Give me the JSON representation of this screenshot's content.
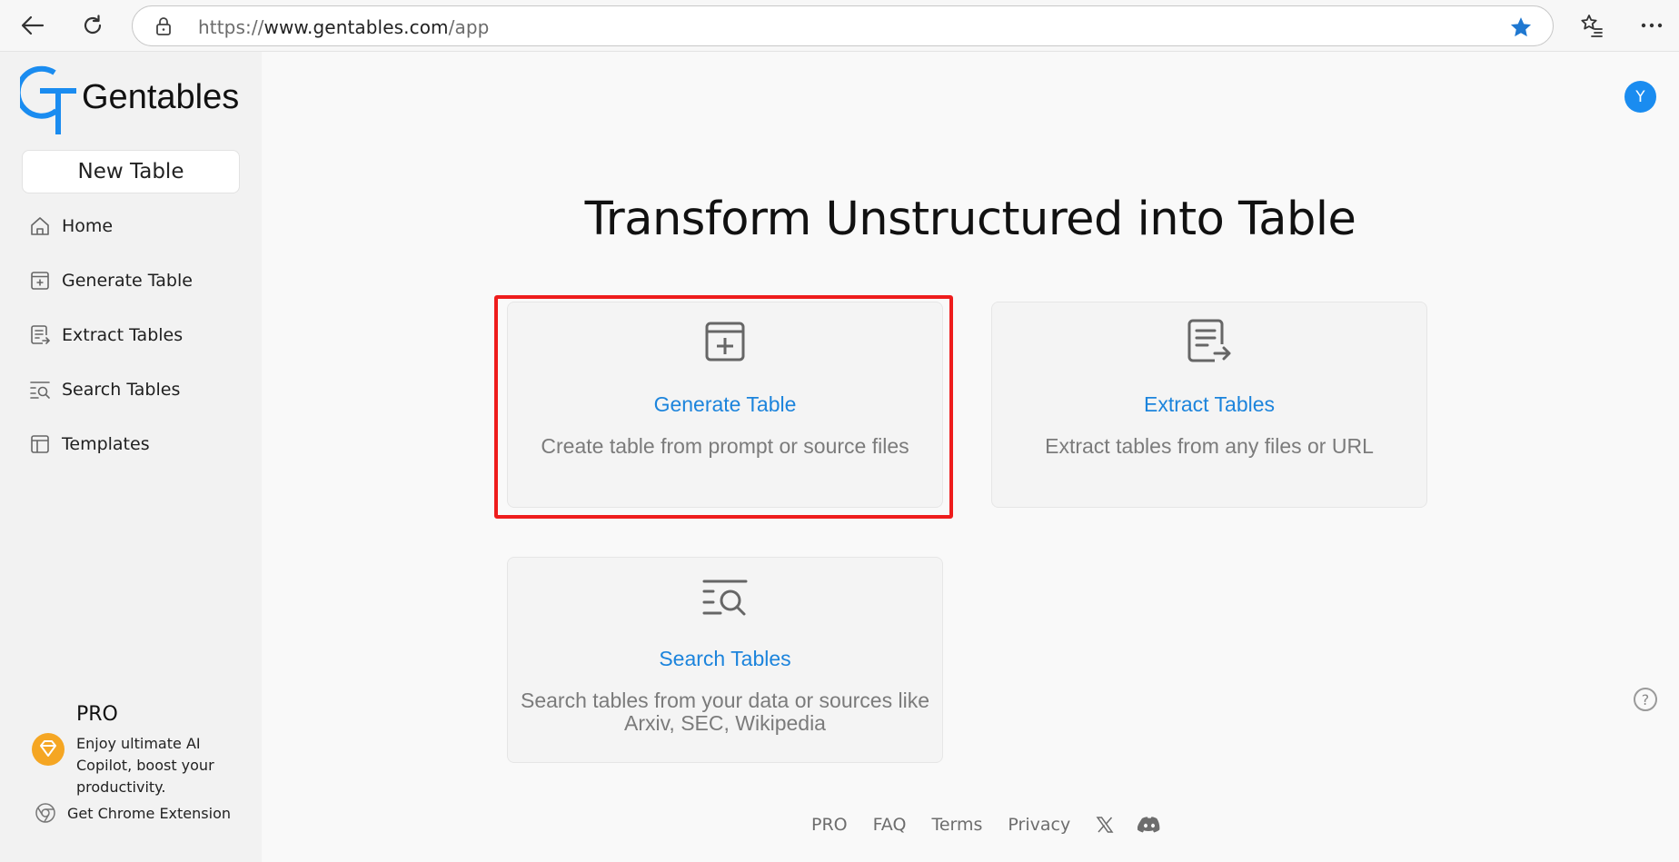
{
  "browser": {
    "url_prefix": "https://",
    "url_host": "www.gentables.com",
    "url_path": "/app"
  },
  "sidebar": {
    "logo_text": "Gentables",
    "new_table_label": "New Table",
    "items": [
      {
        "label": "Home",
        "icon": "home-icon"
      },
      {
        "label": "Generate Table",
        "icon": "table-plus-icon"
      },
      {
        "label": "Extract Tables",
        "icon": "document-arrow-icon"
      },
      {
        "label": "Search Tables",
        "icon": "list-search-icon"
      },
      {
        "label": "Templates",
        "icon": "layout-icon"
      }
    ],
    "pro": {
      "title": "PRO",
      "description": "Enjoy ultimate AI Copilot, boost your productivity."
    },
    "chrome_extension_label": "Get Chrome Extension"
  },
  "header": {
    "avatar_initial": "Y"
  },
  "main": {
    "title": "Transform Unstructured into Table",
    "cards": [
      {
        "title": "Generate Table",
        "description": "Create table from prompt or source files",
        "icon": "table-plus-icon"
      },
      {
        "title": "Extract Tables",
        "description": "Extract tables from any files or URL",
        "icon": "document-arrow-icon"
      },
      {
        "title": "Search Tables",
        "description": "Search tables from your data or sources like Arxiv, SEC, Wikipedia",
        "icon": "list-search-icon"
      }
    ]
  },
  "footer": {
    "links": [
      "PRO",
      "FAQ",
      "Terms",
      "Privacy"
    ],
    "social": [
      "x-icon",
      "discord-icon"
    ]
  },
  "colors": {
    "accent": "#1c84dc",
    "avatar": "#1a8cf0",
    "highlight": "#ee1c1c",
    "pro_badge": "#f5a623"
  }
}
